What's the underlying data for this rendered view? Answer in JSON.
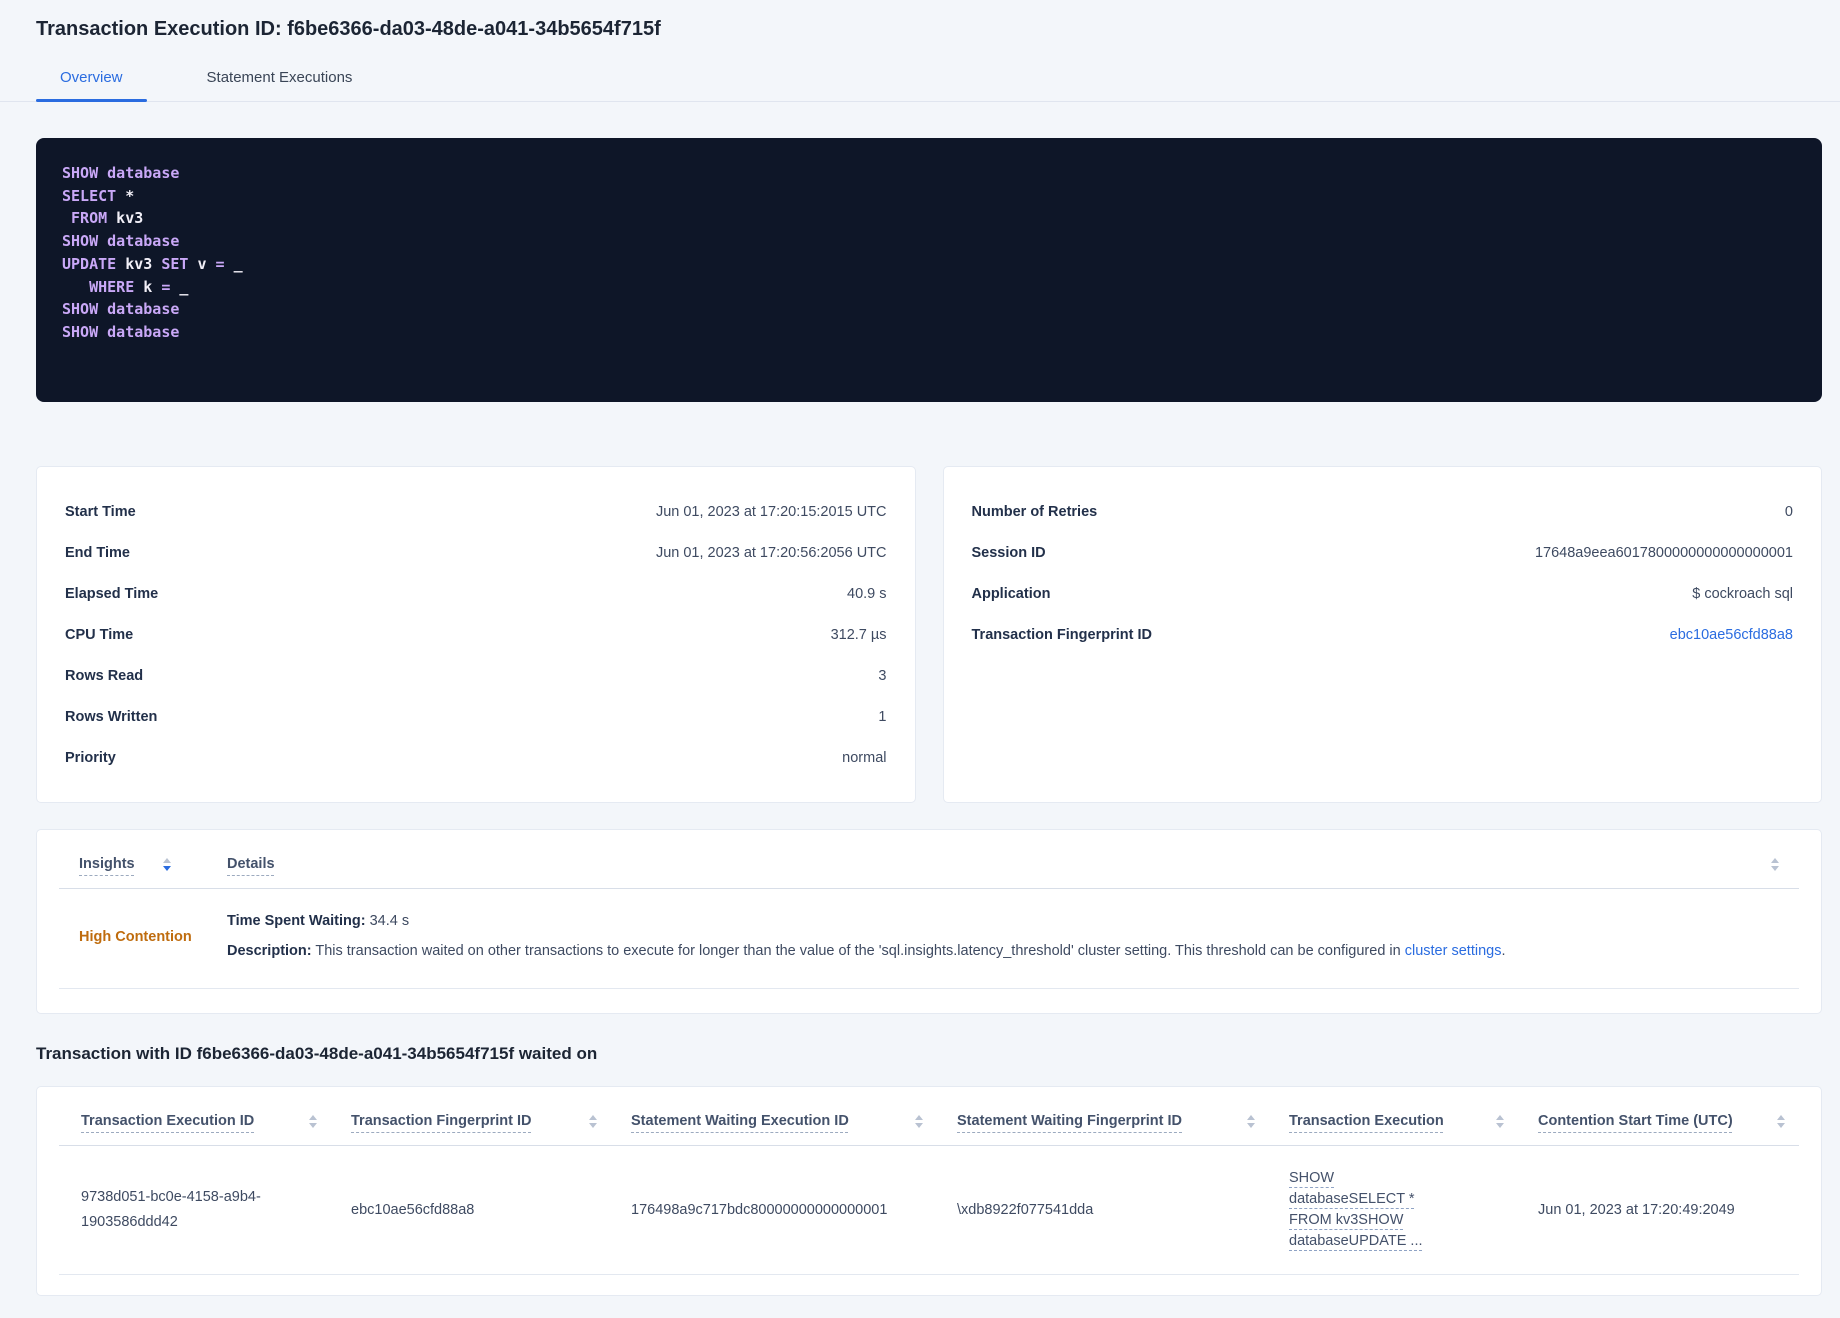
{
  "header": {
    "title": "Transaction Execution ID: f6be6366-da03-48de-a041-34b5654f715f",
    "tabs": [
      {
        "label": "Overview",
        "active": true
      },
      {
        "label": "Statement Executions",
        "active": false
      }
    ]
  },
  "sql": {
    "lines": [
      {
        "tokens": [
          {
            "t": "SHOW database",
            "c": "kw"
          }
        ]
      },
      {
        "tokens": [
          {
            "t": "SELECT",
            "c": "kw"
          },
          {
            "t": " *",
            "c": "pl"
          }
        ]
      },
      {
        "tokens": [
          {
            "t": " ",
            "c": "pl"
          },
          {
            "t": "FROM",
            "c": "kw"
          },
          {
            "t": " kv3",
            "c": "pl"
          }
        ]
      },
      {
        "tokens": [
          {
            "t": "SHOW database",
            "c": "kw"
          }
        ]
      },
      {
        "tokens": [
          {
            "t": "UPDATE",
            "c": "kw"
          },
          {
            "t": " kv3 ",
            "c": "pl"
          },
          {
            "t": "SET",
            "c": "kw"
          },
          {
            "t": " v ",
            "c": "pl"
          },
          {
            "t": "=",
            "c": "kw"
          },
          {
            "t": " _",
            "c": "pl"
          }
        ]
      },
      {
        "tokens": [
          {
            "t": "   ",
            "c": "pl"
          },
          {
            "t": "WHERE",
            "c": "kw"
          },
          {
            "t": " k ",
            "c": "pl"
          },
          {
            "t": "=",
            "c": "kw"
          },
          {
            "t": " _",
            "c": "pl"
          }
        ]
      },
      {
        "tokens": [
          {
            "t": "SHOW database",
            "c": "kw"
          }
        ]
      },
      {
        "tokens": [
          {
            "t": "SHOW database",
            "c": "kw"
          }
        ]
      }
    ]
  },
  "summary": {
    "left": {
      "rows": [
        {
          "label": "Start Time",
          "value": "Jun 01, 2023 at 17:20:15:2015 UTC"
        },
        {
          "label": "End Time",
          "value": "Jun 01, 2023 at 17:20:56:2056 UTC"
        },
        {
          "label": "Elapsed Time",
          "value": "40.9 s"
        },
        {
          "label": "CPU Time",
          "value": "312.7 µs"
        },
        {
          "label": "Rows Read",
          "value": "3"
        },
        {
          "label": "Rows Written",
          "value": "1"
        },
        {
          "label": "Priority",
          "value": "normal"
        }
      ]
    },
    "right": {
      "rows": [
        {
          "label": "Number of Retries",
          "value": "0"
        },
        {
          "label": "Session ID",
          "value": "17648a9eea6017800000000000000001"
        },
        {
          "label": "Application",
          "value": "$ cockroach sql"
        },
        {
          "label": "Transaction Fingerprint ID",
          "value": "ebc10ae56cfd88a8",
          "link": true
        }
      ]
    }
  },
  "insights": {
    "col_insights": "Insights",
    "col_details": "Details",
    "row": {
      "insight": "High Contention",
      "waiting_label": "Time Spent Waiting:",
      "waiting_value": " 34.4 s",
      "description_label": "Description:",
      "description_text": " This transaction waited on other transactions to execute for longer than the value of the 'sql.insights.latency_threshold' cluster setting. This threshold can be configured in ",
      "description_link": "cluster settings",
      "description_suffix": "."
    }
  },
  "waited_on": {
    "heading": "Transaction with ID f6be6366-da03-48de-a041-34b5654f715f waited on",
    "columns": [
      "Transaction Execution ID",
      "Transaction Fingerprint ID",
      "Statement Waiting Execution ID",
      "Statement Waiting Fingerprint ID",
      "Transaction Execution",
      "Contention Start Time (UTC)"
    ],
    "row": {
      "transaction_execution_id": "9738d051-bc0e-4158-a9b4-1903586ddd42",
      "transaction_fingerprint_id": "ebc10ae56cfd88a8",
      "statement_waiting_execution_id": "176498a9c717bdc80000000000000001",
      "statement_waiting_fingerprint_id": "\\xdb8922f077541dda",
      "transaction_execution": "SHOW databaseSELECT * FROM kv3SHOW databaseUPDATE ...",
      "contention_start_time": "Jun 01, 2023 at 17:20:49:2049"
    }
  },
  "colors": {
    "accent_blue": "#2a6ce0",
    "insight_orange": "#bf6c0e",
    "code_background": "#0e1628",
    "code_keyword": "#c9a8f7",
    "code_text": "#f2f0f8"
  }
}
